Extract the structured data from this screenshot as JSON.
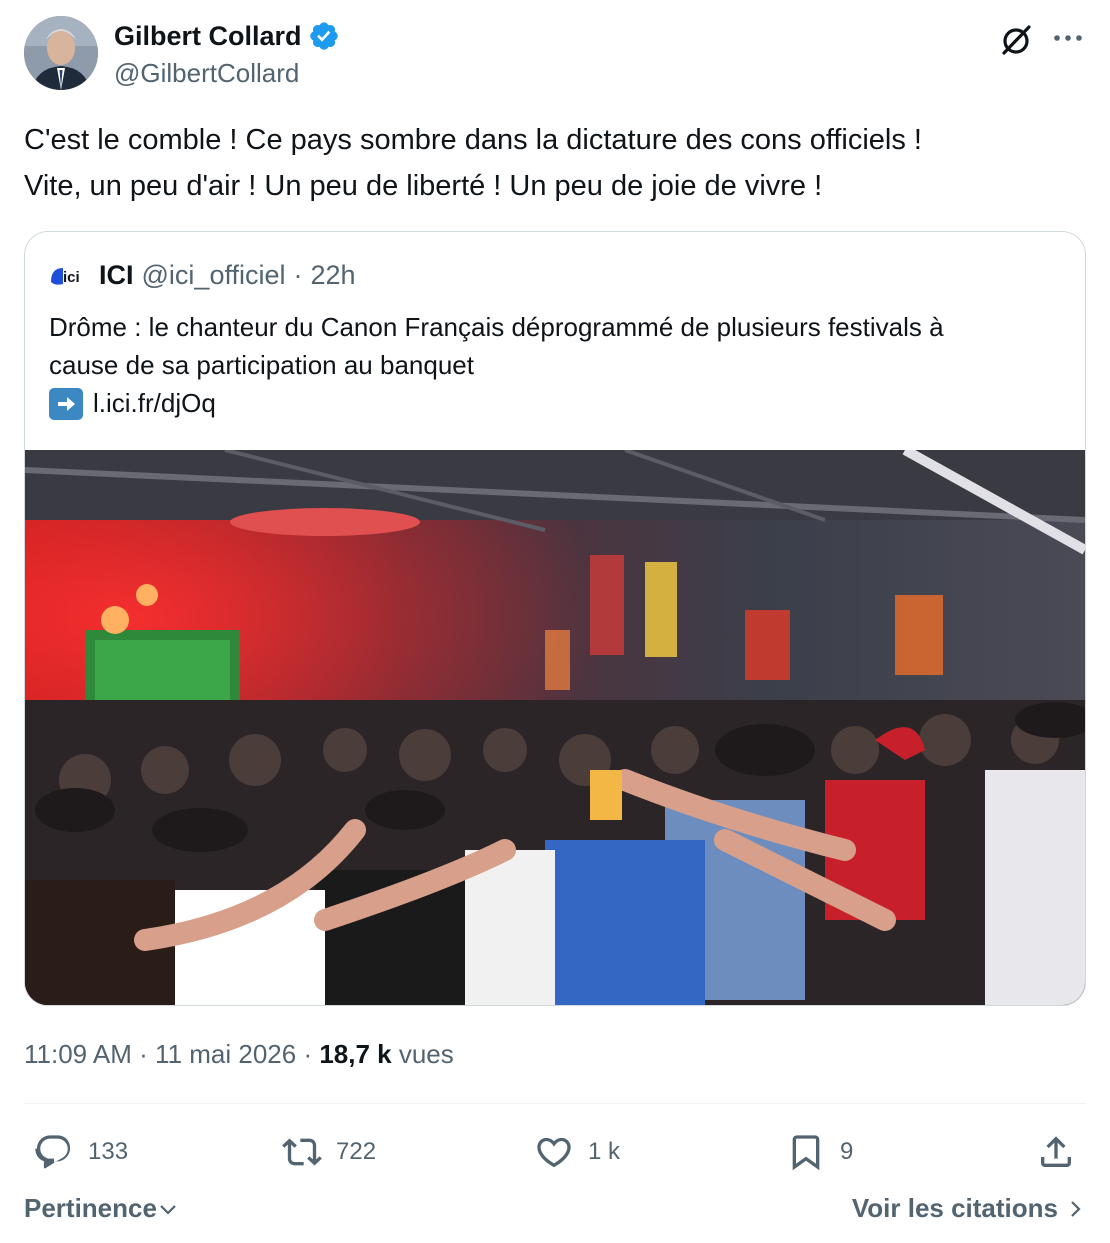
{
  "author": {
    "display_name": "Gilbert Collard",
    "handle": "@GilbertCollard",
    "verified": true
  },
  "tweet": {
    "lines": [
      "C'est le comble ! Ce pays sombre dans la dictature des cons officiels !",
      "Vite, un peu d'air ! Un peu de liberté ! Un peu de joie de vivre !"
    ]
  },
  "quoted": {
    "logo_text": "ici",
    "name": "ICI",
    "handle": "@ici_officiel",
    "separator": "·",
    "time": "22h",
    "text_lines": [
      "Drôme : le chanteur du Canon Français déprogrammé de plusieurs festivals à",
      "cause de sa participation au banquet"
    ],
    "link": "l.ici.fr/djOq",
    "photo_icon": "crowd-photo"
  },
  "meta": {
    "time": "11:09 AM",
    "sep1": " · ",
    "date": "11 mai 2026",
    "sep2": " · ",
    "views_count": "18,7 k",
    "views_label": " vues"
  },
  "actions": {
    "replies": "133",
    "reposts": "722",
    "likes": "1 k",
    "bookmarks": "9"
  },
  "footer": {
    "sort_label": "Pertinence",
    "quotes_label": "Voir les citations"
  },
  "colors": {
    "verified": "#1d9bf0",
    "text": "#0f1419",
    "secondary": "#536471",
    "border": "#cfd9de"
  },
  "icons": [
    "verified-icon",
    "grok-icon",
    "more-icon",
    "arrow-right-icon",
    "reply-icon",
    "repost-icon",
    "like-icon",
    "bookmark-icon",
    "share-icon",
    "chevron-down-icon",
    "chevron-right-icon"
  ]
}
